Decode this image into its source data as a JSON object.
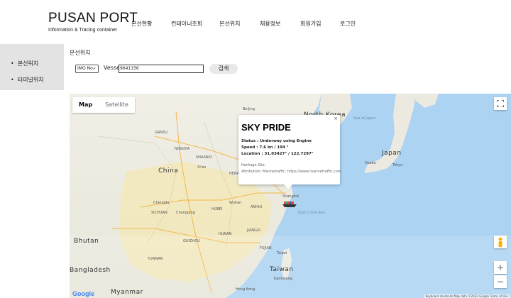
{
  "logo": {
    "title": "PUSAN PORT",
    "subtitle": "Information & Tracing container"
  },
  "nav": [
    "본선현황",
    "컨테이너조회",
    "본선위치",
    "채용정보",
    "회원가입",
    "로그인"
  ],
  "sidebar": [
    "본선위치",
    "터미널위치"
  ],
  "section_title": "본선위치",
  "search": {
    "type_select": "IMO No.",
    "vessel_label": "Vessel",
    "vessel_value": "9641156",
    "button": "검색"
  },
  "map": {
    "toggle": [
      "Map",
      "Satellite"
    ],
    "popup": {
      "title": "SKY PRIDE",
      "status": "Status : Underway using Engine",
      "speed": "Speed : 7.6 kn / 194 °",
      "location": "Location : 31.03427° / 122.7297°",
      "note1": "Heritage Site.",
      "note2": "Attribution: Marinetraffic, https://www.marinetraffic.com",
      "close": "×"
    },
    "labels": {
      "china": "China",
      "japan": "Japan",
      "taiwan": "Taiwan",
      "bangladesh": "Bangladesh",
      "bhutan": "Bhutan",
      "myanmar": "Myanmar",
      "north_korea": "North Korea",
      "beijing": "Beijing",
      "shanghai": "Shanghai",
      "wuhan": "Wuhan",
      "chengdu": "Chengdu",
      "chongqing": "Chongqing",
      "xian": "Xi'an",
      "hong_kong": "Hong Kong",
      "osaka": "Osaka",
      "tokyo": "Tokyo",
      "taipei": "Taipei",
      "sea_of_japan": "Sea of Japan",
      "east_china_sea": "East China Sea",
      "gansu": "GANSU",
      "shaanxi": "SHAANXI",
      "sichuan": "SICHUAN",
      "hubei": "HUBEI",
      "hunan": "HUNAN",
      "guizhou": "GUIZHOU",
      "yunnan": "YUNNAN",
      "jiangxi": "JIANGXI",
      "fujian": "FUJIAN",
      "henan": "HENAN",
      "anhui": "ANHUI",
      "ningxia": "NINGXIA",
      "kaohsiung": "Kaohsiung"
    },
    "attribution": "Keyboard shortcuts   Map data ©2022 Google   Terms of Use",
    "google": "Google",
    "zoom_in": "+",
    "zoom_out": "−"
  }
}
